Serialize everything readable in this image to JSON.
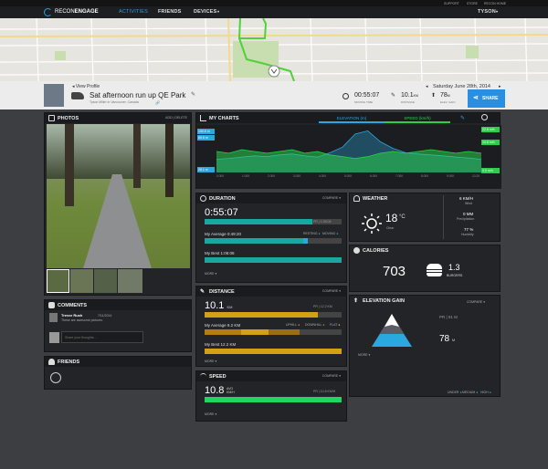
{
  "topbar": {
    "support": "SUPPORT",
    "store": "STORE",
    "home": "RECON HOME"
  },
  "nav": {
    "brand_recon": "RECON",
    "brand_engage": "ENGAGE",
    "activities": "ACTIVITIES",
    "friends": "FRIENDS",
    "devices": "DEVICES",
    "user": "TYSON"
  },
  "header": {
    "view_profile": "◂ View Profile",
    "title": "Sat afternoon run up QE Park",
    "subtitle": "Tyson Miller in Vancouver, Canada",
    "date": "Saturday June 28th, 2014",
    "moving_time": "00:55:07",
    "moving_label": "MOVING TIME",
    "distance": "10.1",
    "distance_unit": "KM",
    "distance_label": "DISTANCE",
    "elev_gain": "78",
    "elev_unit": "M",
    "elev_label": "ELEV. GAIN",
    "share": "SHARE"
  },
  "photos": {
    "title": "PHOTOS",
    "actions": "ADD | DELETE"
  },
  "comments": {
    "title": "COMMENTS",
    "author": "Trevor Rush",
    "time": "7/11/2014",
    "text": "These are awesome pictures.",
    "placeholder": "Share your thoughts..."
  },
  "friends": {
    "title": "FRIENDS"
  },
  "charts": {
    "title": "MY CHARTS",
    "elev_tab": "ELEVATION (m)",
    "speed_tab": "SPEED (km/h)",
    "left_vals": [
      "100.5 m",
      "69.5 m",
      "28.1 m"
    ],
    "right_vals": [
      "22.8 m/h",
      "10.8 m/h",
      "0.0 m/h"
    ],
    "ticks": [
      "0.00K",
      "1.00K",
      "2.00K",
      "3.00K",
      "4.00K",
      "5.00K",
      "6.00K",
      "7.00K",
      "8.00K",
      "9.00K",
      "10.2K"
    ]
  },
  "duration": {
    "title": "DURATION",
    "compare": "COMPARE ▾",
    "value": "0:55:07",
    "pr": "PR | 1:06:08",
    "avg_label": "My Average 0:49:20",
    "resting": "RESTING",
    "moving": "MOVING",
    "best_label": "My Best 1:06:08",
    "more": "MORE ▾"
  },
  "distance": {
    "title": "DISTANCE",
    "compare": "COMPARE ▾",
    "value": "10.1",
    "unit": "KM",
    "pr": "PR | 12.2 KM",
    "avg_label": "My Average 9.2 KM",
    "uphill": "UPHILL",
    "downhill": "DOWNHILL",
    "flat": "FLAT",
    "best_label": "My Best 12.2 KM",
    "more": "MORE ▾"
  },
  "speed": {
    "title": "SPEED",
    "compare": "COMPARE ▾",
    "value": "10.8",
    "unit": "AVG KM/H",
    "pr": "PR | 10.8 KM/H",
    "more": "MORE ▾"
  },
  "weather": {
    "title": "WEATHER",
    "temp": "18",
    "unit": "°C",
    "cond": "Clear",
    "wind": "6 KM/H",
    "wind_label": "Wind",
    "precip": "0 MM",
    "precip_label": "Precipitation",
    "hum": "77 %",
    "hum_label": "Humidity"
  },
  "calories": {
    "title": "CALORIES",
    "value": "703",
    "burgers": "1.3",
    "burgers_label": "BURGERS"
  },
  "elevation": {
    "title": "ELEVATION GAIN",
    "compare": "COMPARE ▾",
    "pr": "PR | 91 M",
    "value": "78",
    "unit": "M",
    "more": "MORE ▾",
    "legend_under": "UNDER",
    "legend_medium": "MEDIUM",
    "legend_high": "HIGH"
  },
  "chart_data": {
    "type": "area",
    "series": [
      {
        "name": "ELEVATION (m)",
        "values": [
          30,
          32,
          35,
          38,
          36,
          40,
          42,
          38,
          35,
          45,
          58,
          88,
          95,
          70,
          55,
          45,
          42,
          40,
          38,
          35,
          33,
          30
        ]
      },
      {
        "name": "SPEED (km/h)",
        "values": [
          12,
          11,
          13,
          12,
          11,
          12,
          13,
          11,
          12,
          10,
          9,
          8,
          9,
          11,
          12,
          11,
          12,
          13,
          12,
          11,
          12,
          11
        ]
      }
    ]
  }
}
